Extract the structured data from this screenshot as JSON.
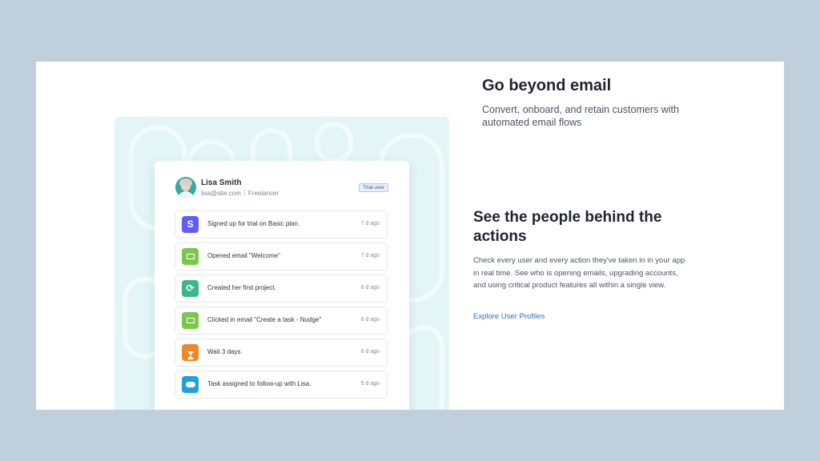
{
  "headline_primary": {
    "title": "Go beyond email",
    "description": "Convert, onboard, and retain customers with automated email flows"
  },
  "headline_secondary": {
    "title": "See the people behind the actions",
    "description": "Check every user and every action they've taken in in your app in real time. See who is opening emails, upgrading accounts, and using critical product features all within a single view.",
    "link_label": "Explore User Profiles"
  },
  "profile": {
    "name": "Lisa Smith",
    "email": "lisa@site.com",
    "role": "Freelancer",
    "badge": "Trial user"
  },
  "activities": [
    {
      "icon": "stripe-icon",
      "glyph": "S",
      "color": "#635bff",
      "text": "Signed up for trial on Basic plan.",
      "time": "7 d ago"
    },
    {
      "icon": "email-icon",
      "glyph": "",
      "color": "#7ac84a",
      "text": "Opened email \"Welcome\"",
      "time": "7 d ago"
    },
    {
      "icon": "sync-icon",
      "glyph": "⟳",
      "color": "#3fb58a",
      "text": "Created her first project.",
      "time": "6 d ago"
    },
    {
      "icon": "email-icon",
      "glyph": "",
      "color": "#7ac84a",
      "text": "Clicked in email \"Create a task - Nudge\"",
      "time": "6 d ago"
    },
    {
      "icon": "hourglass-icon",
      "glyph": "",
      "color": "#f0882a",
      "text": "Wait 3 days.",
      "time": "6 d ago"
    },
    {
      "icon": "salesforce-icon",
      "glyph": "",
      "color": "#1ea0da",
      "text": "Task assigned to follow-up with Lisa.",
      "time": "5 d ago"
    }
  ]
}
